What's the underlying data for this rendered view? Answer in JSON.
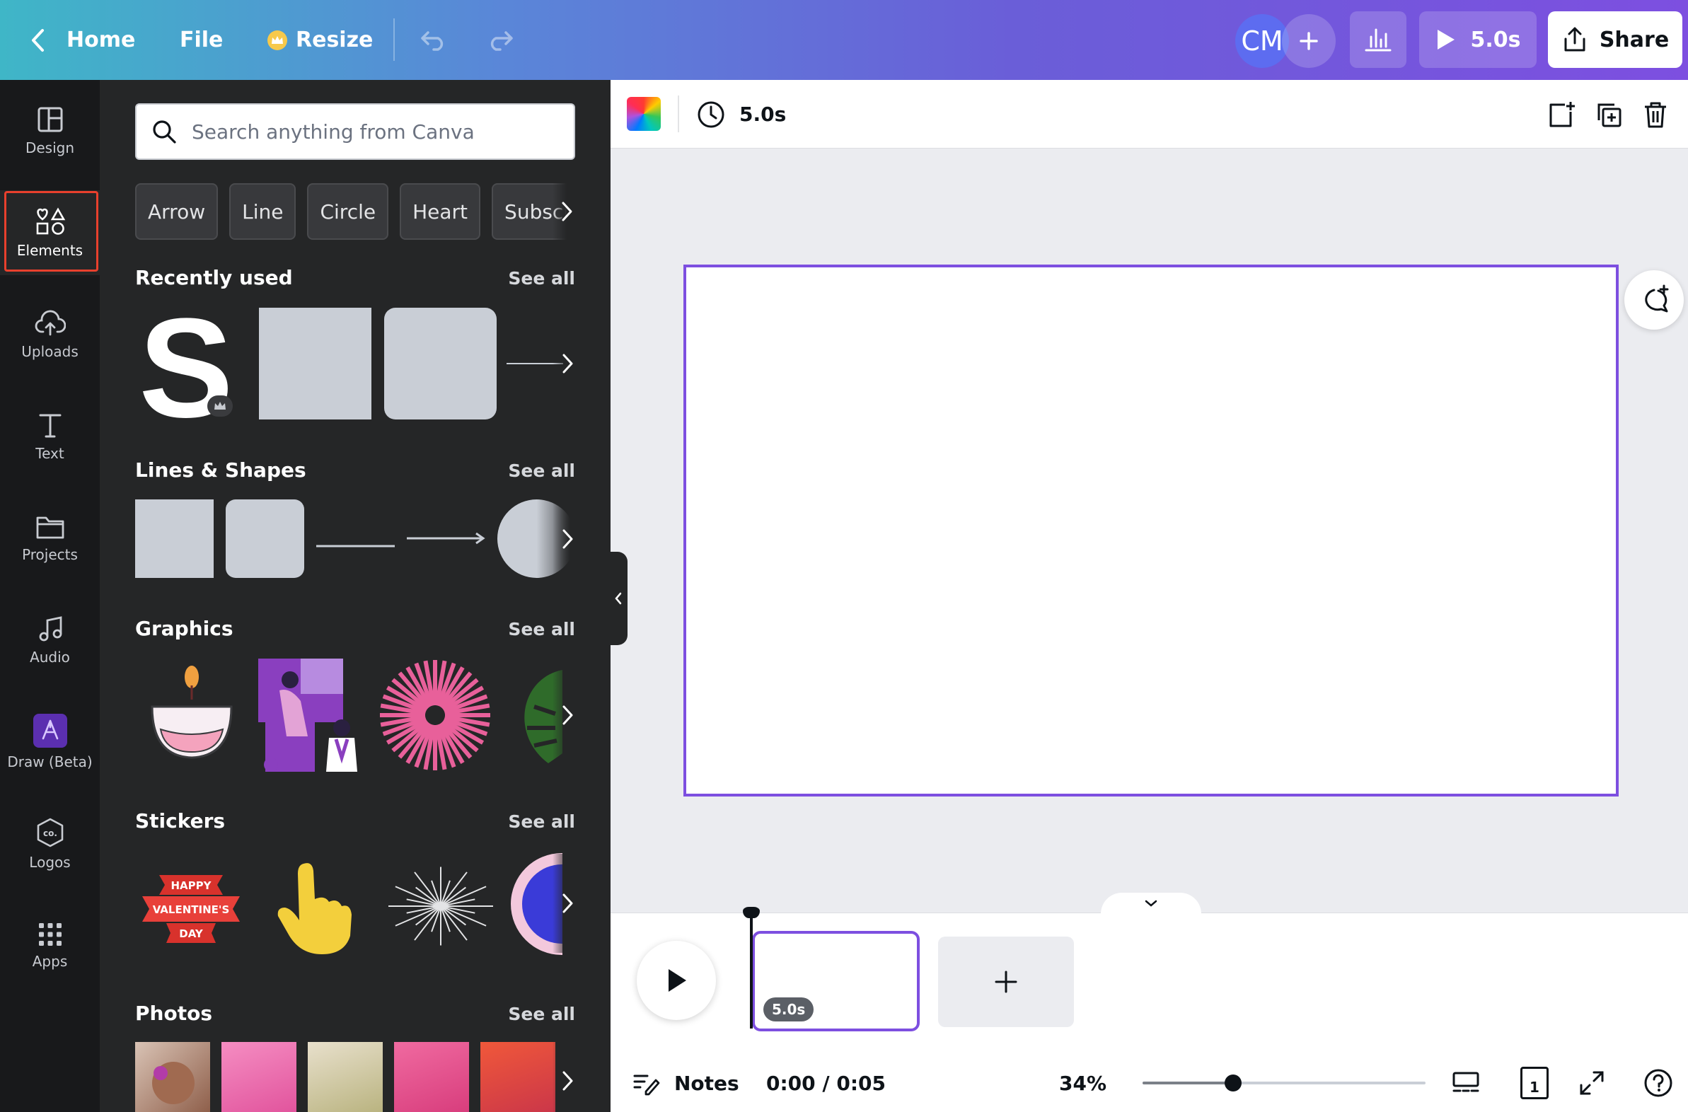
{
  "topbar": {
    "home_label": "Home",
    "file_label": "File",
    "resize_label": "Resize",
    "avatar_initials": "CM",
    "play_duration": "5.0s",
    "share_label": "Share",
    "accent_color": "#7d4fe0"
  },
  "rail": {
    "items": [
      {
        "label": "Design",
        "icon": "design-layout-icon"
      },
      {
        "label": "Elements",
        "icon": "elements-shapes-icon",
        "active": true
      },
      {
        "label": "Uploads",
        "icon": "cloud-upload-icon"
      },
      {
        "label": "Text",
        "icon": "text-T-icon"
      },
      {
        "label": "Projects",
        "icon": "folder-icon"
      },
      {
        "label": "Audio",
        "icon": "music-note-icon"
      },
      {
        "label": "Draw (Beta)",
        "icon": "draw-pen-icon"
      },
      {
        "label": "Logos",
        "icon": "logo-badge-icon"
      },
      {
        "label": "Apps",
        "icon": "apps-grid-icon"
      }
    ]
  },
  "panel": {
    "search_placeholder": "Search anything from Canva",
    "chips": [
      "Arrow",
      "Line",
      "Circle",
      "Heart",
      "Subscrib"
    ],
    "see_all": "See all",
    "sections": {
      "recently_used": "Recently used",
      "lines_shapes": "Lines & Shapes",
      "graphics": "Graphics",
      "stickers": "Stickers",
      "photos": "Photos"
    },
    "recent_letter": "S",
    "sticker_text": [
      "HAPPY",
      "VALENTINE'S",
      "DAY"
    ]
  },
  "context_bar": {
    "duration": "5.0s"
  },
  "timeline": {
    "clip_duration": "5.0s"
  },
  "footer": {
    "notes_label": "Notes",
    "time": "0:00 / 0:05",
    "zoom": "34%",
    "zoom_fraction": 0.32,
    "page_count": "1"
  }
}
